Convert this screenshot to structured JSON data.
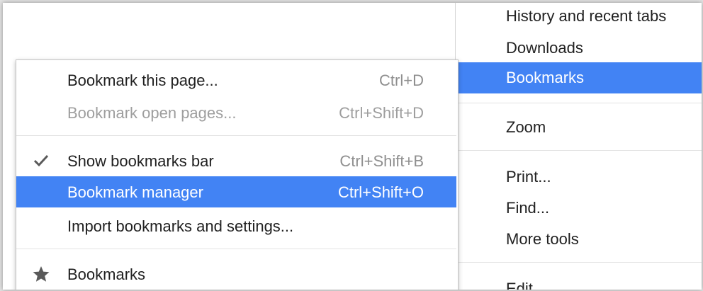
{
  "main_menu": {
    "items": [
      {
        "label": "History and recent tabs"
      },
      {
        "label": "Downloads"
      },
      {
        "label": "Bookmarks"
      },
      {
        "label": "Zoom"
      },
      {
        "label": "Print..."
      },
      {
        "label": "Find..."
      },
      {
        "label": "More tools"
      },
      {
        "label": "Edit"
      }
    ]
  },
  "bookmarks_submenu": {
    "items": [
      {
        "label": "Bookmark this page...",
        "shortcut": "Ctrl+D"
      },
      {
        "label": "Bookmark open pages...",
        "shortcut": "Ctrl+Shift+D"
      },
      {
        "label": "Show bookmarks bar",
        "shortcut": "Ctrl+Shift+B",
        "icon": "checkmark-icon"
      },
      {
        "label": "Bookmark manager",
        "shortcut": "Ctrl+Shift+O"
      },
      {
        "label": "Import bookmarks and settings..."
      },
      {
        "label": "Bookmarks",
        "icon": "star-icon"
      }
    ]
  },
  "colors": {
    "highlight": "#4283f4",
    "text": "#212121",
    "disabled_text": "#9e9e9e",
    "shortcut_text": "#6a6a6a"
  }
}
